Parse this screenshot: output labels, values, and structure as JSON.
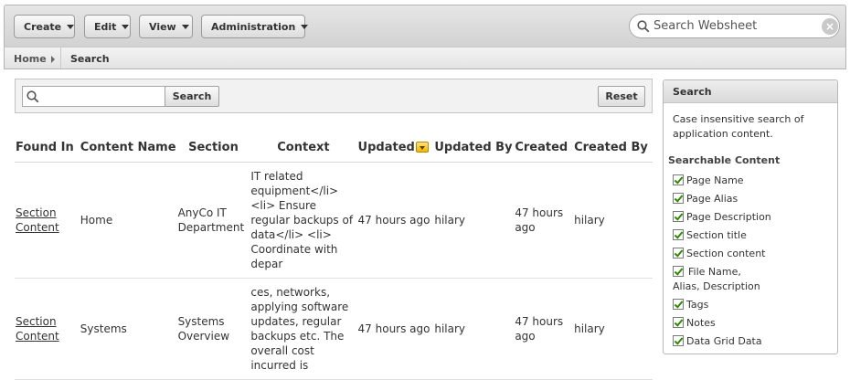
{
  "toolbar": {
    "menus": [
      "Create",
      "Edit",
      "View",
      "Administration"
    ],
    "websheet_search_placeholder": "Search Websheet",
    "clear_glyph": "×"
  },
  "breadcrumb": {
    "home": "Home",
    "current": "Search"
  },
  "search": {
    "input_value": "",
    "search_button": "Search",
    "reset_button": "Reset"
  },
  "results": {
    "columns": [
      "Found In",
      "Content Name",
      "Section",
      "Context",
      "Updated",
      "Updated By",
      "Created",
      "Created By"
    ],
    "sorted_column": "Updated",
    "rows": [
      {
        "found_in": "Section Content",
        "content_name": "Home",
        "section": "AnyCo IT Department",
        "context": "IT related equipment</li> <li> Ensure regular backups of data</li> <li> Coordinate with depar",
        "updated": "47 hours ago",
        "updated_by": "hilary",
        "created": "47 hours ago",
        "created_by": "hilary"
      },
      {
        "found_in": "Section Content",
        "content_name": "Systems",
        "section": "Systems Overview",
        "context": "ces, networks, applying software updates, regular backups etc. The overall cost incurred is",
        "updated": "47 hours ago",
        "updated_by": "hilary",
        "created": "47 hours ago",
        "created_by": "hilary"
      }
    ]
  },
  "side_panel": {
    "title": "Search",
    "description": "Case insensitive search of application content.",
    "subheading": "Searchable Content",
    "options": [
      {
        "label": "Page Name",
        "checked": true
      },
      {
        "label": "Page Alias",
        "checked": true
      },
      {
        "label": "Page Description",
        "checked": true
      },
      {
        "label": "Section title",
        "checked": true
      },
      {
        "label": "Section content",
        "checked": true
      },
      {
        "label": "File Name, Alias, Description",
        "checked": true
      },
      {
        "label": "Tags",
        "checked": true
      },
      {
        "label": "Notes",
        "checked": true
      },
      {
        "label": "Data Grid Data",
        "checked": true
      }
    ]
  }
}
